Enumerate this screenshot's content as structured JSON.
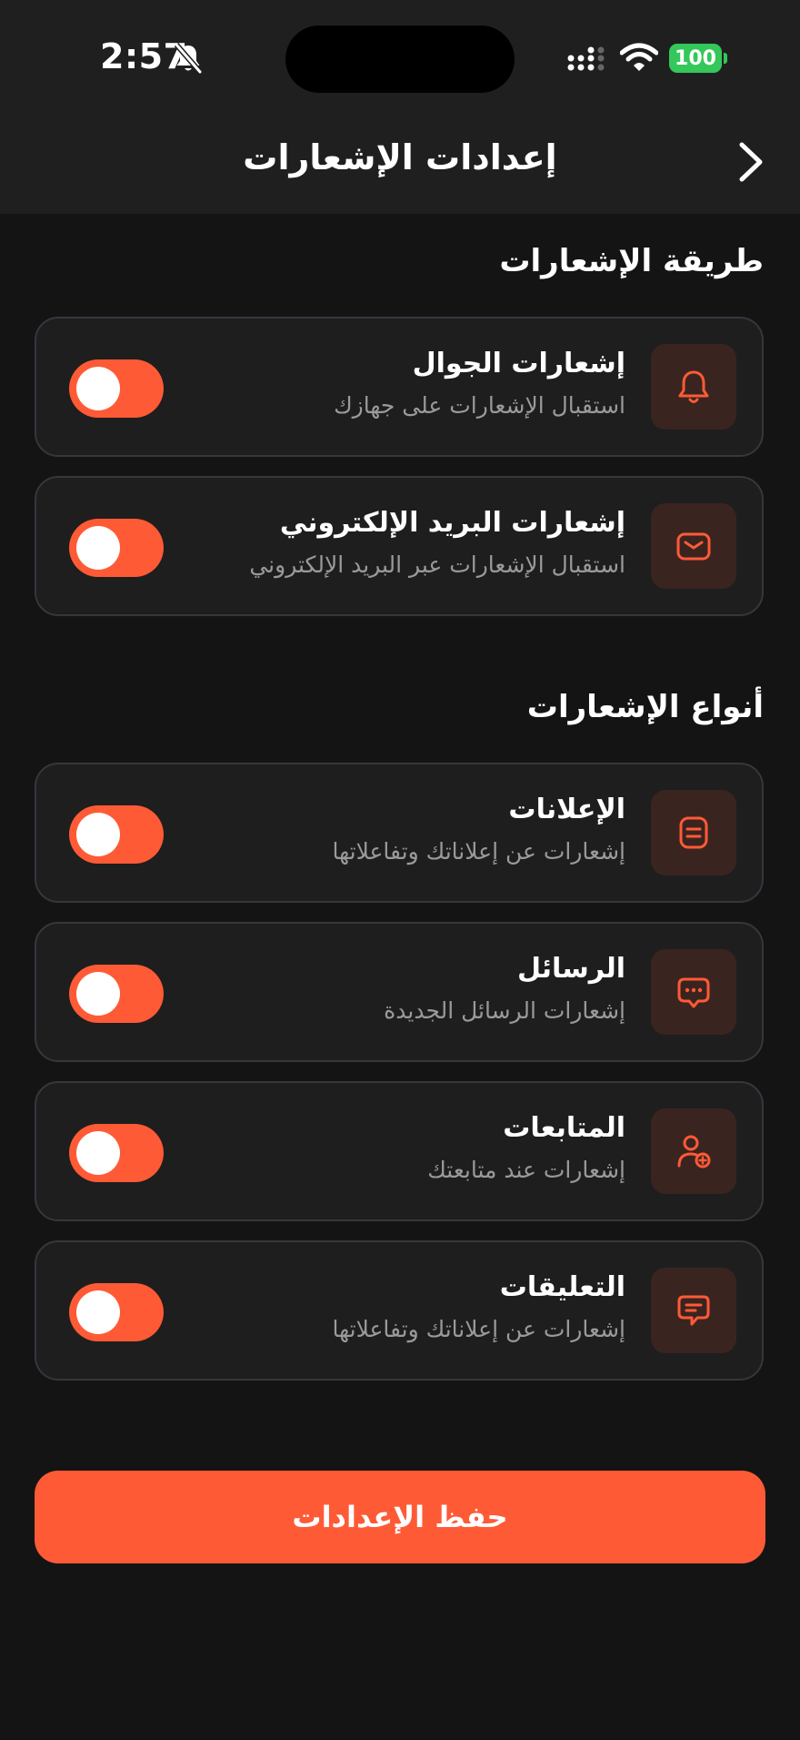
{
  "status_bar": {
    "time": "2:57",
    "battery": "100"
  },
  "header": {
    "title": "إعدادات الإشعارات"
  },
  "sections": {
    "method": {
      "title": "طريقة الإشعارات",
      "items": [
        {
          "title": "إشعارات الجوال",
          "subtitle": "استقبال الإشعارات على جهازك",
          "icon": "bell-icon",
          "enabled": true
        },
        {
          "title": "إشعارات البريد الإلكتروني",
          "subtitle": "استقبال الإشعارات عبر البريد الإلكتروني",
          "icon": "mail-icon",
          "enabled": true
        }
      ]
    },
    "types": {
      "title": "أنواع الإشعارات",
      "items": [
        {
          "title": "الإعلانات",
          "subtitle": "إشعارات عن إعلاناتك وتفاعلاتها",
          "icon": "ads-icon",
          "enabled": true
        },
        {
          "title": "الرسائل",
          "subtitle": "إشعارات الرسائل الجديدة",
          "icon": "chat-bubble-icon",
          "enabled": true
        },
        {
          "title": "المتابعات",
          "subtitle": "إشعارات عند متابعتك",
          "icon": "user-add-icon",
          "enabled": true
        },
        {
          "title": "التعليقات",
          "subtitle": "إشعارات عن إعلاناتك وتفاعلاتها",
          "icon": "comment-icon",
          "enabled": true
        }
      ]
    }
  },
  "actions": {
    "save_label": "حفظ الإعدادات"
  },
  "colors": {
    "accent": "#ff5a36",
    "background": "#141414",
    "card": "#1e1e1e",
    "icon_bg": "#3a2420",
    "battery": "#34c759"
  }
}
